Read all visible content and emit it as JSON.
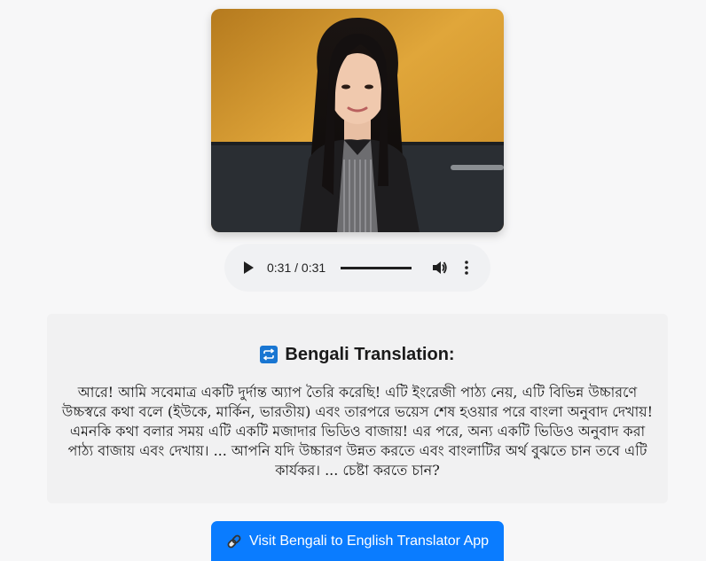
{
  "video": {
    "alt": "presenter-video-still"
  },
  "audio": {
    "time_display": "0:31 / 0:31",
    "progress_fraction": 1.0,
    "icons": {
      "play": "play-icon",
      "volume": "volume-icon",
      "more": "more-options-icon"
    }
  },
  "translation": {
    "heading_icon": "repeat-icon",
    "heading": "Bengali Translation:",
    "text": "আরে! আমি সবেমাত্র একটি দুর্দান্ত অ্যাপ তৈরি করেছি! এটি ইংরেজী পাঠ্য নেয়, এটি বিভিন্ন উচ্চারণে উচ্চস্বরে কথা বলে (ইউকে, মার্কিন, ভারতীয়) এবং তারপরে ভয়েস শেষ হওয়ার পরে বাংলা অনুবাদ দেখায়! এমনকি কথা বলার সময় এটি একটি মজাদার ভিডিও বাজায়! এর পরে, অন্য একটি ভিডিও অনুবাদ করা পাঠ্য বাজায় এবং দেখায়। ... আপনি যদি উচ্চারণ উন্নত করতে এবং বাংলাটির অর্থ বুঝতে চান তবে এটি কার্যকর। ... চেষ্টা করতে চান?"
  },
  "cta": {
    "icon": "link-icon",
    "label": "Visit Bengali to English Translator App",
    "color": "#0a7cff"
  },
  "colors": {
    "background": "#f7f7f8",
    "panel": "#f1f1f2",
    "accent": "#0a7cff"
  }
}
